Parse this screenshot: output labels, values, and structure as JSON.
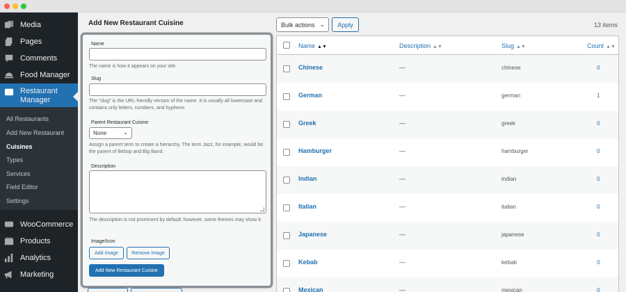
{
  "sidebar": {
    "menu": [
      {
        "label": "Media",
        "icon": "media-icon"
      },
      {
        "label": "Pages",
        "icon": "pages-icon"
      },
      {
        "label": "Comments",
        "icon": "comments-icon"
      },
      {
        "label": "Food Manager",
        "icon": "food-manager-icon"
      },
      {
        "label": "Restaurant Manager",
        "icon": "restaurant-manager-icon",
        "active": true
      }
    ],
    "submenu": [
      {
        "label": "All Restaurants"
      },
      {
        "label": "Add New Restaurant"
      },
      {
        "label": "Cuisines",
        "current": true
      },
      {
        "label": "Types"
      },
      {
        "label": "Services"
      },
      {
        "label": "Field Editor"
      },
      {
        "label": "Settings"
      }
    ],
    "menu2": [
      {
        "label": "WooCommerce",
        "icon": "woocommerce-icon"
      },
      {
        "label": "Products",
        "icon": "products-icon"
      },
      {
        "label": "Analytics",
        "icon": "analytics-icon"
      },
      {
        "label": "Marketing",
        "icon": "marketing-icon"
      }
    ]
  },
  "form": {
    "heading": "Add New Restaurant Cuisine",
    "name_label": "Name",
    "name_help": "The name is how it appears on your site.",
    "slug_label": "Slug",
    "slug_help": "The “slug” is the URL-friendly version of the name. It is usually all lowercase and contains only letters, numbers, and hyphens.",
    "parent_label": "Parent Restaurant Cuisine",
    "parent_value": "None",
    "parent_help": "Assign a parent term to create a hierarchy. The term Jazz, for example, would be the parent of Bebop and Big Band.",
    "description_label": "Description",
    "description_help": "The description is not prominent by default; however, some themes may show it.",
    "image_label": "Image/Icon",
    "add_image": "Add Image",
    "remove_image": "Remove Image",
    "submit": "Add New Restaurant Cuisine"
  },
  "toolbar": {
    "bulk_actions": "Bulk actions",
    "apply": "Apply",
    "items_count": "13 items"
  },
  "table": {
    "columns": {
      "name": "Name",
      "description": "Description",
      "slug": "Slug",
      "count": "Count"
    },
    "rows": [
      {
        "name": "Chinese",
        "description": "—",
        "slug": "chinese",
        "count": "0"
      },
      {
        "name": "German",
        "description": "—",
        "slug": "german",
        "count": "1"
      },
      {
        "name": "Greek",
        "description": "—",
        "slug": "greek",
        "count": "0"
      },
      {
        "name": "Hamburger",
        "description": "—",
        "slug": "hamburger",
        "count": "0"
      },
      {
        "name": "Indian",
        "description": "—",
        "slug": "indian",
        "count": "0"
      },
      {
        "name": "Italian",
        "description": "—",
        "slug": "italian",
        "count": "0"
      },
      {
        "name": "Japanese",
        "description": "—",
        "slug": "japanese",
        "count": "0"
      },
      {
        "name": "Kebab",
        "description": "—",
        "slug": "kebab",
        "count": "0"
      },
      {
        "name": "Mexican",
        "description": "—",
        "slug": "mexican",
        "count": "0"
      }
    ]
  },
  "colors": {
    "accent": "#2271b1",
    "sidebar": "#1d2327",
    "submenu": "#2c3338"
  }
}
